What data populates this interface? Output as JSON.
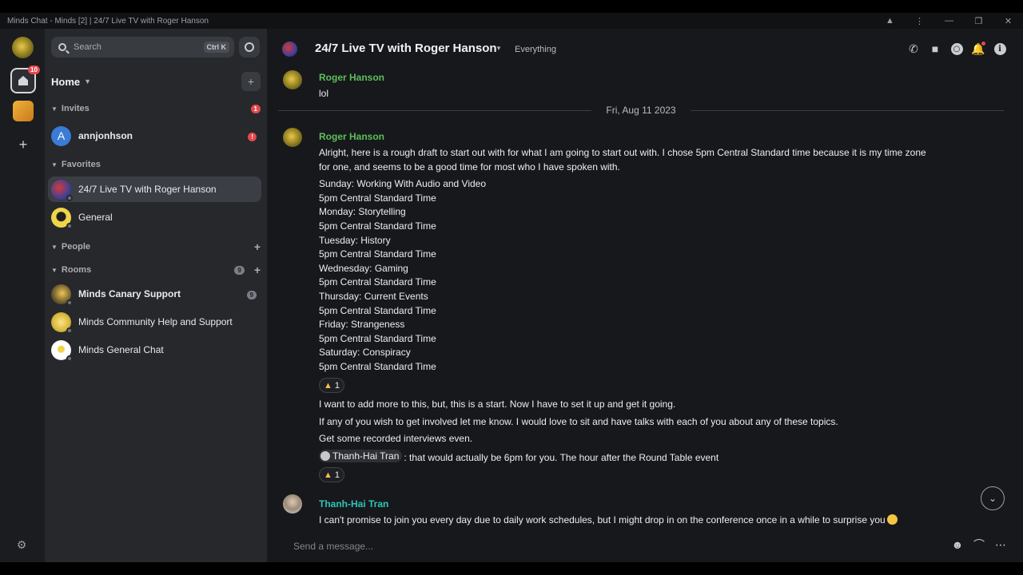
{
  "window": {
    "title": "Minds Chat - Minds [2] | 24/7 Live TV with Roger Hanson"
  },
  "spaces": {
    "home_badge": "10",
    "add_icon": "+"
  },
  "sidebar": {
    "search_placeholder": "Search",
    "search_shortcut": "Ctrl K",
    "home_label": "Home",
    "sections": {
      "invites": {
        "label": "Invites",
        "count": "1"
      },
      "favorites": {
        "label": "Favorites"
      },
      "people": {
        "label": "People"
      },
      "rooms": {
        "label": "Rooms",
        "count": "9"
      }
    },
    "invites": [
      {
        "name": "annjonhson",
        "initial": "A",
        "badge": "!"
      }
    ],
    "favorites": [
      {
        "name": "24/7 Live TV with Roger Hanson",
        "active": true
      },
      {
        "name": "General"
      }
    ],
    "rooms": [
      {
        "name": "Minds Canary Support",
        "count": "9",
        "bold": true
      },
      {
        "name": "Minds Community Help and Support"
      },
      {
        "name": "Minds General Chat"
      }
    ]
  },
  "room": {
    "title": "24/7 Live TV with Roger Hanson",
    "topic": "Everything"
  },
  "timeline": {
    "date_separator": "Fri, Aug 11 2023",
    "messages": [
      {
        "sender": "Roger Hanson",
        "lines": [
          "lol"
        ]
      },
      {
        "sender": "Roger Hanson",
        "lines": [
          "Alright, here is a rough draft to start out with for what I am going to start out with. I chose 5pm Central Standard time because it is my time zone",
          "for one, and seems to be a good time for most who I have spoken with.",
          "Sunday: Working With Audio and Video",
          "5pm Central Standard Time",
          "Monday: Storytelling",
          "5pm Central Standard Time",
          "Tuesday: History",
          "5pm Central Standard Time",
          "Wednesday: Gaming",
          "5pm Central Standard Time",
          "Thursday: Current Events",
          "5pm Central Standard Time",
          "Friday: Strangeness",
          "5pm Central Standard Time",
          "Saturday: Conspiracy",
          "5pm Central Standard Time"
        ],
        "reaction_count": "1"
      },
      {
        "sender": "Roger Hanson",
        "lines": [
          "I want to add more to this, but, this is a start. Now I have to set it up and get it going."
        ]
      },
      {
        "sender": "Roger Hanson",
        "lines": [
          "If any of you wish to get involved let me know. I would love to sit and have talks with each of you about any of these topics."
        ]
      },
      {
        "sender": "Roger Hanson",
        "lines": [
          "Get some recorded interviews even."
        ]
      },
      {
        "sender": "Roger Hanson",
        "mention": "Thanh-Hai Tran",
        "lines": [
          ": that would actually be 6pm for you. The hour after the Round Table event"
        ],
        "reaction_count": "1"
      },
      {
        "sender": "Thanh-Hai Tran",
        "lines": [
          "I can't promise to join you every day due to daily work schedules, but I might drop in on the conference once in a while to surprise you"
        ]
      }
    ]
  },
  "composer": {
    "placeholder": "Send a message..."
  },
  "colors": {
    "accent_green": "#5bbf5a",
    "accent_teal": "#2ec5b6",
    "badge_red": "#e5484d",
    "background": "#17181b",
    "sidebar": "#26282c"
  }
}
